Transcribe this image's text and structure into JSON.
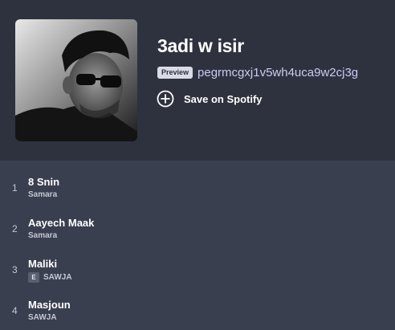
{
  "playlist": {
    "title": "3adi w isir",
    "preview_badge": "Preview",
    "user": "pegrmcgxj1v5wh4uca9w2cj3g",
    "save_label": "Save on Spotify",
    "cover_description": "Black and white photo of young man with sunglasses",
    "plus_icon": "plus-circle-icon"
  },
  "tracks": [
    {
      "number": "1",
      "title": "8 Snin",
      "artist": "Samara",
      "explicit": false
    },
    {
      "number": "2",
      "title": "Aayech Maak",
      "artist": "Samara",
      "explicit": false
    },
    {
      "number": "3",
      "title": "Maliki",
      "artist": "SAWJA",
      "explicit": true,
      "explicit_label": "E"
    },
    {
      "number": "4",
      "title": "Masjoun",
      "artist": "SAWJA",
      "explicit": false
    }
  ],
  "colors": {
    "header_bg": "#2e323f",
    "list_bg": "#3a3f50",
    "link": "#c9ccf0",
    "text_secondary": "#c4c7d2"
  }
}
